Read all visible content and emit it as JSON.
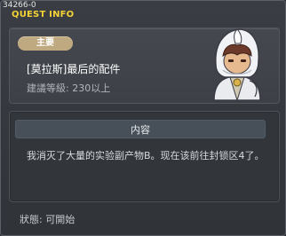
{
  "window": {
    "quest_id": "34266-0",
    "title": "QUEST INFO"
  },
  "header": {
    "badge": "主要",
    "quest_name": "[莫拉斯]最后的配件",
    "recommended_level": "建議等級: 230以上"
  },
  "content": {
    "section_label": "内容",
    "description": "我消灭了大量的实验副产物B。现在该前往封锁区4了。"
  },
  "footer": {
    "status": "狀態: 可開始"
  },
  "colors": {
    "title": "#f3d236",
    "badge": "#bfa981",
    "section_bar": "#475059"
  },
  "icons": {
    "portrait": "hooded-npc-portrait"
  }
}
